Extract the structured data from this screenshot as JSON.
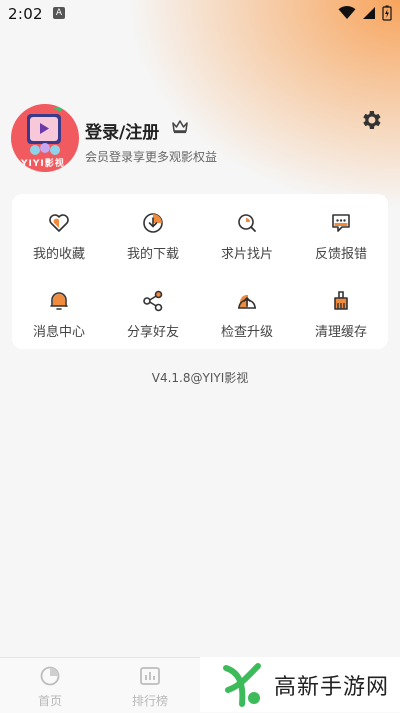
{
  "status_bar": {
    "time": "2:02",
    "notif_letter": "A"
  },
  "profile": {
    "title": "登录/注册",
    "subtitle": "会员登录享更多观影权益",
    "avatar_text": "YIYI影视"
  },
  "grid": {
    "items": [
      {
        "label": "我的收藏",
        "icon": "heart-icon"
      },
      {
        "label": "我的下载",
        "icon": "download-icon"
      },
      {
        "label": "求片找片",
        "icon": "search-film-icon"
      },
      {
        "label": "反馈报错",
        "icon": "feedback-icon"
      },
      {
        "label": "消息中心",
        "icon": "bell-icon"
      },
      {
        "label": "分享好友",
        "icon": "share-icon"
      },
      {
        "label": "检查升级",
        "icon": "upgrade-icon"
      },
      {
        "label": "清理缓存",
        "icon": "broom-icon"
      }
    ]
  },
  "version": "V4.1.8@YIYI影视",
  "bottom_nav": {
    "home": "首页",
    "ranking": "排行榜"
  },
  "watermark": {
    "text": "高新手游网"
  },
  "colors": {
    "accent": "#f08a3c",
    "brand_red": "#f15a5e"
  }
}
